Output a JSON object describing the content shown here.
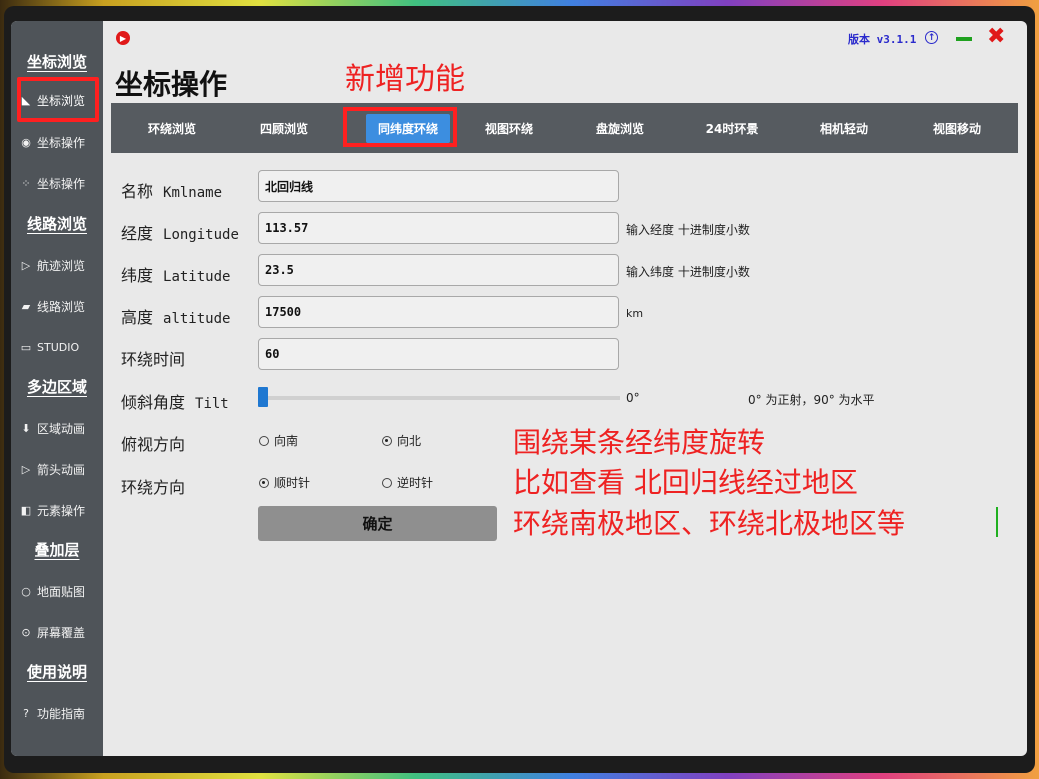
{
  "window": {
    "version_label": "版本 v3.1.1",
    "minimize_glyph": "—",
    "close_glyph": "✖"
  },
  "sidebar": {
    "sections": [
      {
        "header": "坐标浏览",
        "items": [
          {
            "icon": "leaf-icon",
            "glyph": "◣",
            "label": "坐标浏览"
          },
          {
            "icon": "radio-icon",
            "glyph": "◉",
            "label": "坐标操作"
          },
          {
            "icon": "nodes-icon",
            "glyph": "⁘",
            "label": "坐标操作"
          }
        ]
      },
      {
        "header": "线路浏览",
        "items": [
          {
            "icon": "send-icon",
            "glyph": "▷",
            "label": "航迹浏览"
          },
          {
            "icon": "car-icon",
            "glyph": "🚘",
            "label": "线路浏览"
          },
          {
            "icon": "camera-icon",
            "glyph": "▭",
            "label": "STUDIO"
          }
        ]
      },
      {
        "header": "多边区域",
        "items": [
          {
            "icon": "download-icon",
            "glyph": "⬇",
            "label": "区域动画"
          },
          {
            "icon": "arrow-icon",
            "glyph": "▷",
            "label": "箭头动画"
          },
          {
            "icon": "element-icon",
            "glyph": "◧",
            "label": "元素操作"
          }
        ]
      },
      {
        "header": "叠加层",
        "items": [
          {
            "icon": "circle-icon",
            "glyph": "○",
            "label": "地面贴图"
          },
          {
            "icon": "clock-icon",
            "glyph": "⊙",
            "label": "屏幕覆盖"
          }
        ]
      },
      {
        "header": "使用说明",
        "items": [
          {
            "icon": "question-icon",
            "glyph": "?",
            "label": "功能指南"
          }
        ]
      }
    ]
  },
  "main": {
    "title": "坐标操作",
    "annotation_new": "新增功能",
    "tabs": [
      "环绕浏览",
      "四顾浏览",
      "同纬度环绕",
      "视图环绕",
      "盘旋浏览",
      "24时环景",
      "相机轻动",
      "视图移动"
    ],
    "active_tab_index": 2,
    "form": {
      "name_label": "名称",
      "name_en": "Kmlname",
      "name_value": "北回归线",
      "lon_label": "经度",
      "lon_en": "Longitude",
      "lon_value": "113.57",
      "lon_hint": "输入经度 十进制度小数",
      "lat_label": "纬度",
      "lat_en": "Latitude",
      "lat_value": "23.5",
      "lat_hint": "输入纬度 十进制度小数",
      "alt_label": "高度",
      "alt_en": "altitude",
      "alt_value": "17500",
      "alt_hint": "km",
      "time_label": "环绕时间",
      "time_value": "60",
      "tilt_label": "倾斜角度",
      "tilt_en": "Tilt",
      "tilt_value": "0°",
      "tilt_hint": "0° 为正射，90° 为水平",
      "tilt_level": 0,
      "view_dir_label": "俯视方向",
      "view_south": "向南",
      "view_north": "向北",
      "view_selected": "向北",
      "orbit_dir_label": "环绕方向",
      "orbit_cw": "顺时针",
      "orbit_ccw": "逆时针",
      "orbit_selected": "顺时针",
      "confirm_label": "确定"
    },
    "annotation_lines": [
      "围绕某条经纬度旋转",
      "比如查看  北回归线经过地区",
      "环绕南极地区、环绕北极地区等"
    ]
  },
  "colors": {
    "sidebar_bg": "#4f5459",
    "tabbar_bg": "#565b60",
    "active_tab": "#3c8ee0",
    "highlight_box": "#ff2020",
    "annotation_text": "#ee2222"
  }
}
